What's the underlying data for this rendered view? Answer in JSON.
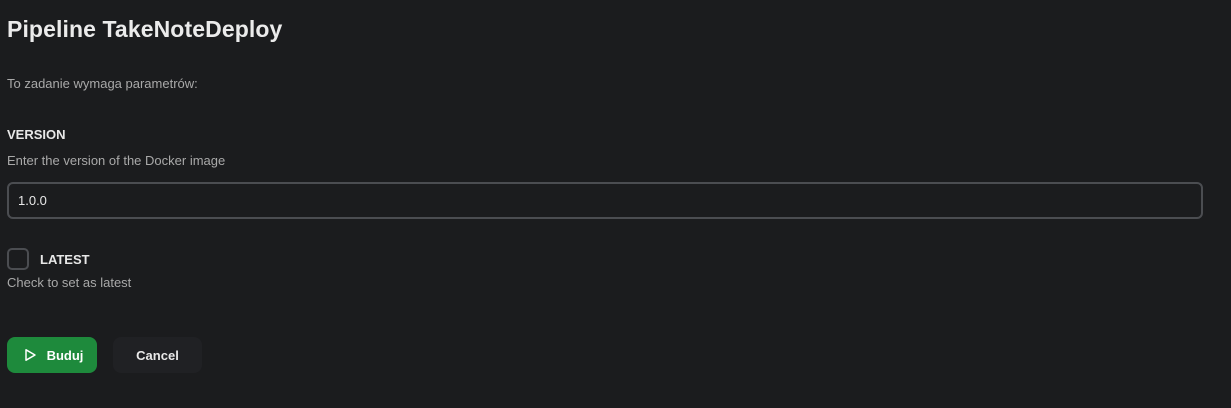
{
  "page": {
    "title": "Pipeline TakeNoteDeploy",
    "intro": "To zadanie wymaga parametrów:"
  },
  "params": {
    "version": {
      "name": "VERSION",
      "description": "Enter the version of the Docker image",
      "value": "1.0.0"
    },
    "latest": {
      "name": "LATEST",
      "description": "Check to set as latest",
      "checked": false
    }
  },
  "actions": {
    "build_label": "Buduj",
    "build_icon": "play-icon",
    "cancel_label": "Cancel"
  },
  "colors": {
    "background": "#1b1c1e",
    "build_button": "#1e8a3c",
    "input_border": "#4b4d51"
  }
}
